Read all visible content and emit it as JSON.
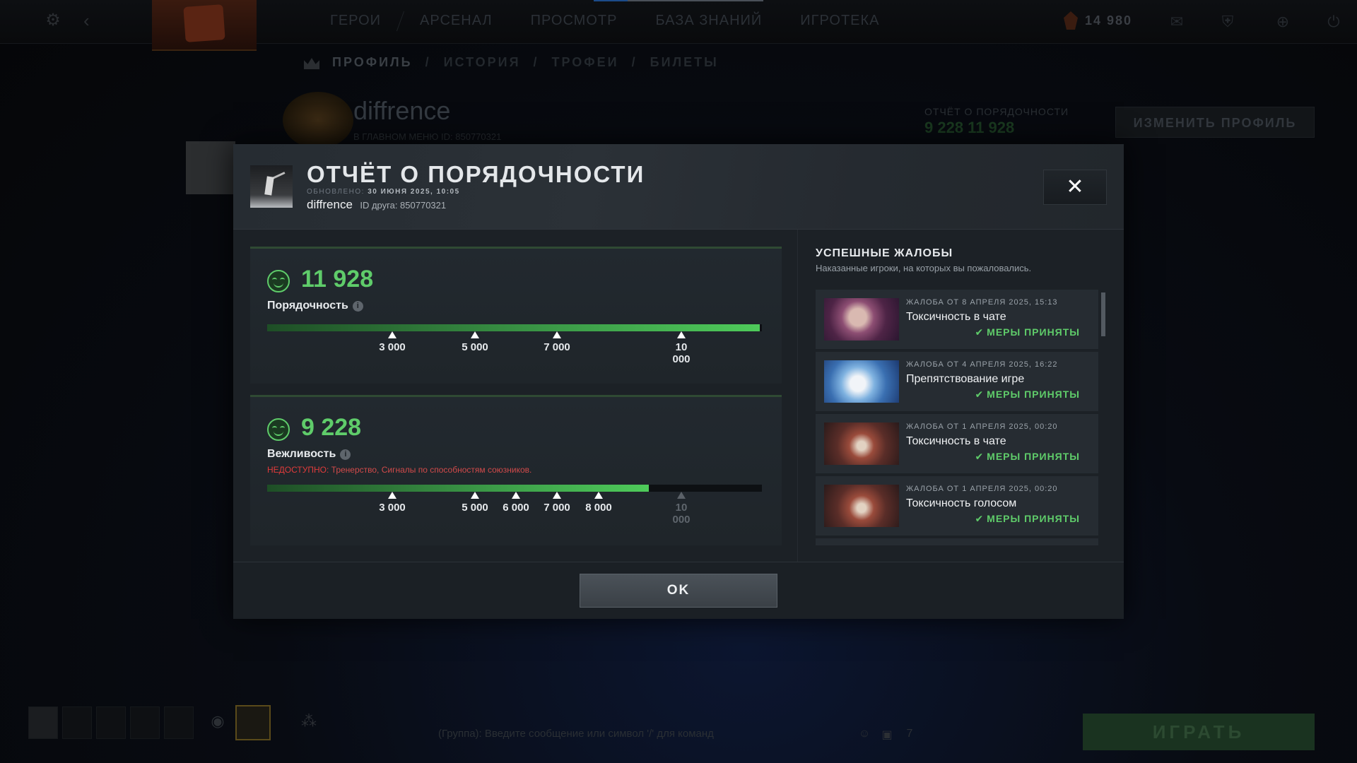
{
  "background": {
    "nav": [
      "ГЕРОИ",
      "АРСЕНАЛ",
      "ПРОСМОТР",
      "БАЗА ЗНАНИЙ",
      "ИГРОТЕКА"
    ],
    "shards": "14 980",
    "subnav": [
      "ПРОФИЛЬ",
      "/",
      "ИСТОРИЯ",
      "/",
      "ТРОФЕИ",
      "/",
      "БИЛЕТЫ"
    ],
    "profile_name": "diffrence",
    "profile_sub": "В ГЛАВНОМ МЕНЮ   ID: 850770321",
    "conduct_title": "ОТЧЁТ О ПОРЯДОЧНОСТИ",
    "conduct_values": "9 228   11 928",
    "edit_profile": "ИЗМЕНИТЬ ПРОФИЛЬ",
    "chat_placeholder": "(Группа): Введите сообщение или символ '/' для команд",
    "chat_count": "7",
    "play_button": "ИГРАТЬ"
  },
  "modal": {
    "title": "ОТЧЁТ О ПОРЯДОЧНОСТИ",
    "updated_label": "ОБНОВЛЕНО:",
    "updated_value": "30 ИЮНЯ 2025, 10:05",
    "username": "diffrence",
    "friend_id": "ID друга: 850770321",
    "close_symbol": "✕",
    "ok_label": "OK"
  },
  "conduct": {
    "score": "11 928",
    "label": "Порядочность",
    "progress": 0.995,
    "ticks": [
      "3 000",
      "5 000",
      "7 000",
      "10\n000"
    ]
  },
  "behavior": {
    "score": "9 228",
    "label": "Вежливость",
    "warning_key": "НЕДОСТУПНО:",
    "warning_text": "Тренерство, Сигналы по способностям союзников.",
    "progress": 0.772,
    "ticks": [
      "3 000",
      "5 000",
      "6 000",
      "7 000",
      "8 000",
      "10\n000"
    ]
  },
  "reports": {
    "title": "УСПЕШНЫЕ ЖАЛОБЫ",
    "subtitle": "Наказанные игроки, на которых вы пожаловались.",
    "items": [
      {
        "date": "ЖАЛОБА ОТ 8 АПРЕЛЯ 2025, 15:13",
        "reason": "Токсичность в чате",
        "status": "МЕРЫ ПРИНЯТЫ",
        "hero": "invoker"
      },
      {
        "date": "ЖАЛОБА ОТ 4 АПРЕЛЯ 2025, 16:22",
        "reason": "Препятствование игре",
        "status": "МЕРЫ ПРИНЯТЫ",
        "hero": "zeus"
      },
      {
        "date": "ЖАЛОБА ОТ 1 АПРЕЛЯ 2025, 00:20",
        "reason": "Токсичность в чате",
        "status": "МЕРЫ ПРИНЯТЫ",
        "hero": "beast"
      },
      {
        "date": "ЖАЛОБА ОТ 1 АПРЕЛЯ 2025, 00:20",
        "reason": "Токсичность голосом",
        "status": "МЕРЫ ПРИНЯТЫ",
        "hero": "beast"
      }
    ]
  },
  "colors": {
    "accent_green": "#5fcc6a",
    "warning_red": "#e03b3b",
    "modal_bg": "#1c2126"
  }
}
